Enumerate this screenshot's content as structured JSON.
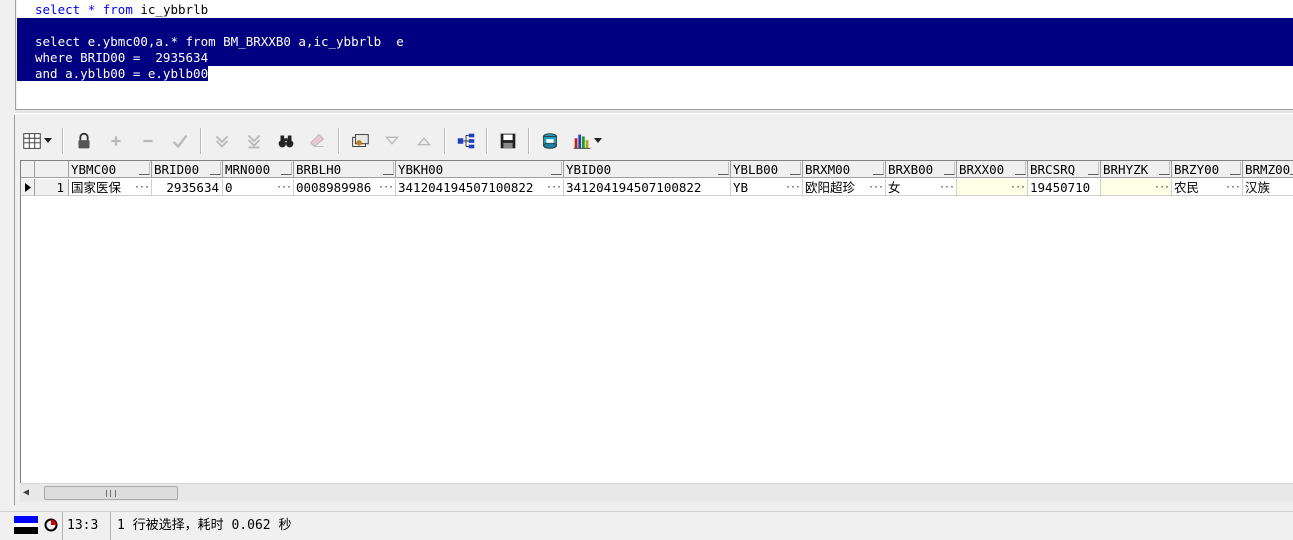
{
  "editor": {
    "lines": [
      {
        "parts": [
          {
            "text": "select",
            "style": "kw"
          },
          {
            "text": " ",
            "style": "plain"
          },
          {
            "text": "*",
            "style": "kw"
          },
          {
            "text": " ",
            "style": "plain"
          },
          {
            "text": "from",
            "style": "kw"
          },
          {
            "text": " ic_ybbrlb",
            "style": "plain"
          }
        ],
        "selected": false
      },
      {
        "parts": [
          {
            "text": "",
            "style": "plain"
          }
        ],
        "selected": true
      },
      {
        "parts": [
          {
            "text": "select e.ybmc00,a.* from BM_BRXXB0 a,ic_ybbrlb  e",
            "style": "plain"
          }
        ],
        "selected": true
      },
      {
        "parts": [
          {
            "text": "where BRID00 =  2935634",
            "style": "plain"
          }
        ],
        "selected": true
      },
      {
        "parts": [
          {
            "text": "and a.yblb00 = e.yblb00",
            "style": "plain"
          }
        ],
        "selected": "partial"
      }
    ]
  },
  "toolbar": {
    "buttons": [
      {
        "name": "grid-view-icon",
        "enabled": true,
        "dropdown": true
      },
      {
        "name": "sep"
      },
      {
        "name": "lock-icon",
        "enabled": true
      },
      {
        "name": "add-record-icon",
        "enabled": false
      },
      {
        "name": "delete-record-icon",
        "enabled": false
      },
      {
        "name": "post-changes-icon",
        "enabled": false
      },
      {
        "name": "sep"
      },
      {
        "name": "fetch-next-page-icon",
        "enabled": false
      },
      {
        "name": "fetch-last-page-icon",
        "enabled": false
      },
      {
        "name": "find-binoculars-icon",
        "enabled": true
      },
      {
        "name": "clear-eraser-icon",
        "enabled": false
      },
      {
        "name": "sep"
      },
      {
        "name": "query-by-example-icon",
        "enabled": true
      },
      {
        "name": "filter-down-icon",
        "enabled": false
      },
      {
        "name": "filter-up-icon",
        "enabled": false
      },
      {
        "name": "sep"
      },
      {
        "name": "tree-view-icon",
        "enabled": true
      },
      {
        "name": "sep"
      },
      {
        "name": "save-icon",
        "enabled": true
      },
      {
        "name": "sep"
      },
      {
        "name": "export-icon",
        "enabled": true
      },
      {
        "name": "bar-chart-icon",
        "enabled": true,
        "dropdown": true
      }
    ]
  },
  "grid": {
    "columns": [
      {
        "name": "YBMC00"
      },
      {
        "name": "BRID00"
      },
      {
        "name": "MRN000"
      },
      {
        "name": "BRBLH0"
      },
      {
        "name": "YBKH00"
      },
      {
        "name": "YBID00"
      },
      {
        "name": "YBLB00"
      },
      {
        "name": "BRXM00"
      },
      {
        "name": "BRXB00"
      },
      {
        "name": "BRXX00"
      },
      {
        "name": "BRCSRQ"
      },
      {
        "name": "BRHYZK"
      },
      {
        "name": "BRZY00"
      },
      {
        "name": "BRMZ00"
      }
    ],
    "rows": [
      {
        "row_number": "1",
        "cells": [
          {
            "value": "国家医保",
            "dots": true
          },
          {
            "value": "2935634",
            "align": "right",
            "dots": false
          },
          {
            "value": "0",
            "dots": true
          },
          {
            "value": "0008989986",
            "dots": true
          },
          {
            "value": "341204194507100822",
            "dots": true
          },
          {
            "value": "341204194507100822",
            "dots": false
          },
          {
            "value": "YB",
            "dots": true
          },
          {
            "value": "欧阳超珍",
            "dots": true
          },
          {
            "value": "女",
            "dots": true
          },
          {
            "value": "",
            "null": true,
            "dots": true
          },
          {
            "value": "19450710",
            "dots": false
          },
          {
            "value": "",
            "null": true,
            "dots": true
          },
          {
            "value": "农民",
            "dots": true
          },
          {
            "value": "汉族",
            "dots": false
          }
        ]
      }
    ]
  },
  "status": {
    "position": "13:3",
    "message": "1 行被选择，耗时 0.062 秒"
  },
  "colors": {
    "selection": "#000080",
    "keyword": "#0000ff",
    "null_cell": "#ffffe6"
  }
}
